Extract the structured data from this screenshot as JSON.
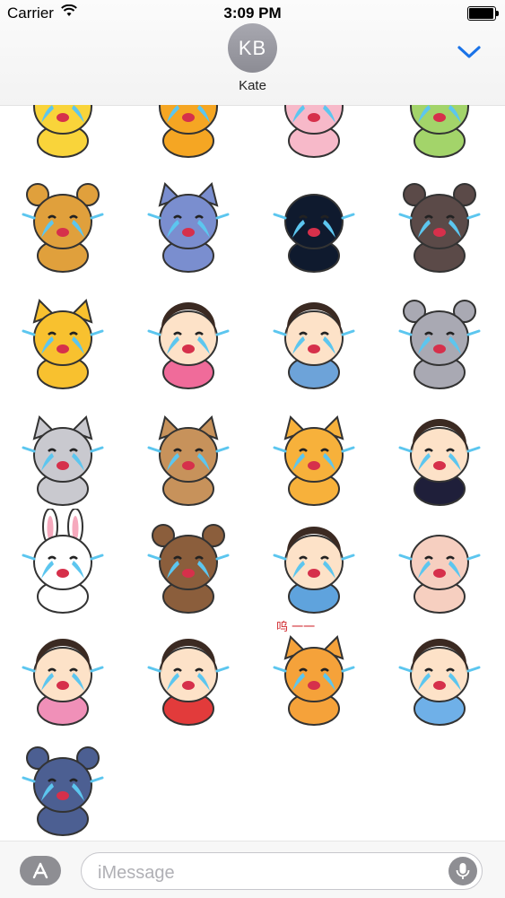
{
  "status_bar": {
    "carrier": "Carrier",
    "time": "3:09 PM",
    "battery_level": 0.95
  },
  "header": {
    "avatar_initials": "KB",
    "contact_name": "Kate"
  },
  "stickers": [
    {
      "name": "sticker-chick-crying",
      "kind": "round",
      "color": "#f9d43a"
    },
    {
      "name": "sticker-giraffe-crying",
      "kind": "giraffe",
      "color": "#f5a623"
    },
    {
      "name": "sticker-pink-pig-crying",
      "kind": "round",
      "color": "#f7b9c9"
    },
    {
      "name": "sticker-green-blob-crying",
      "kind": "round",
      "color": "#a3d46a"
    },
    {
      "name": "sticker-lion-crying",
      "kind": "bear",
      "color": "#e0a03c"
    },
    {
      "name": "sticker-blue-wolf-crying",
      "kind": "cat",
      "color": "#7a8ecf"
    },
    {
      "name": "sticker-black-blob-crying",
      "kind": "round",
      "color": "#0f1a2e"
    },
    {
      "name": "sticker-dark-bear-crying",
      "kind": "bear",
      "color": "#5b4a48"
    },
    {
      "name": "sticker-yellow-cat-crying",
      "kind": "cat",
      "color": "#f8c12f"
    },
    {
      "name": "sticker-girl-crying",
      "kind": "person",
      "color": "#f06b9a"
    },
    {
      "name": "sticker-boy-crying",
      "kind": "person",
      "color": "#6da3d9"
    },
    {
      "name": "sticker-gray-mouse-crying",
      "kind": "bear",
      "color": "#a9a9b3"
    },
    {
      "name": "sticker-gray-cat-crying",
      "kind": "cat",
      "color": "#c9c9cf"
    },
    {
      "name": "sticker-shiba-dog-crying",
      "kind": "cat",
      "color": "#c7925b"
    },
    {
      "name": "sticker-orange-cat-crying",
      "kind": "cat",
      "color": "#f7b13b"
    },
    {
      "name": "sticker-top-hat-man-crying",
      "kind": "person",
      "color": "#1f1f3a"
    },
    {
      "name": "sticker-white-bunny-crying",
      "kind": "bunny",
      "color": "#ffffff"
    },
    {
      "name": "sticker-brown-bear-crying",
      "kind": "bear",
      "color": "#8b5e3c"
    },
    {
      "name": "sticker-boy-hands-face-crying",
      "kind": "person",
      "color": "#5fa3dd"
    },
    {
      "name": "sticker-pig-hat-crying",
      "kind": "round",
      "color": "#f6cfc0"
    },
    {
      "name": "sticker-girl-sitting-crying",
      "kind": "person",
      "color": "#f090b8"
    },
    {
      "name": "sticker-curly-boy-crying",
      "kind": "person",
      "color": "#e23b3b"
    },
    {
      "name": "sticker-tiger-crying",
      "kind": "cat",
      "color": "#f5a23a"
    },
    {
      "name": "sticker-hooded-kid-crying",
      "kind": "person",
      "color": "#6fb0e8"
    },
    {
      "name": "sticker-blue-dog-crying",
      "kind": "bear",
      "color": "#4c5f92"
    }
  ],
  "tiger_caption": "呜 一一",
  "compose": {
    "placeholder": "iMessage"
  },
  "icons": {
    "wifi": "wifi-icon",
    "battery": "battery-icon",
    "collapse": "chevron-down-icon",
    "app_store": "app-store-icon",
    "mic": "microphone-icon"
  },
  "colors": {
    "accent": "#1a73e8",
    "tears": "#5cc6ef"
  }
}
